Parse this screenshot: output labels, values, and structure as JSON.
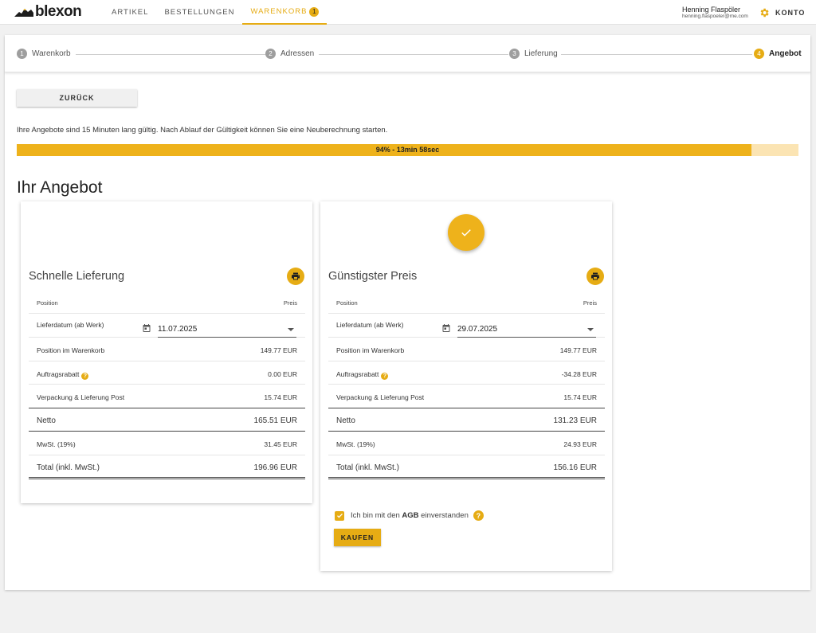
{
  "brand": {
    "name": "blexon",
    "accent": "#e6ac14"
  },
  "nav": {
    "artikel": "ARTIKEL",
    "bestellungen": "BESTELLUNGEN",
    "warenkorb": "WARENKORB",
    "warenkorb_count": "1"
  },
  "user": {
    "name": "Henning Flaspöler",
    "email": "henning.flaspoeler@me.com",
    "konto": "KONTO"
  },
  "stepper": [
    {
      "num": "1",
      "label": "Warenkorb"
    },
    {
      "num": "2",
      "label": "Adressen"
    },
    {
      "num": "3",
      "label": "Lieferung"
    },
    {
      "num": "4",
      "label": "Angebot"
    }
  ],
  "back_label": "ZURÜCK",
  "info_text": "Ihre Angebote sind 15 Minuten lang gültig. Nach Ablauf der Gültigkeit können Sie eine Neuberechnung starten.",
  "progress": {
    "percent": 94,
    "label": "94% - 13min 58sec"
  },
  "offers_title": "Ihr Angebot",
  "offers": [
    {
      "name": "Schnelle Lieferung",
      "col_position": "Position",
      "col_preis": "Preis",
      "lieferdatum_label": "Lieferdatum (ab Werk)",
      "lieferdatum": "11.07.2025",
      "warenkorb_label": "Position im Warenkorb",
      "warenkorb": "149.77 EUR",
      "rabatt_label": "Auftragsrabatt",
      "rabatt": "0.00 EUR",
      "versand_label": "Verpackung & Lieferung Post",
      "versand": "15.74 EUR",
      "netto_label": "Netto",
      "netto": "165.51 EUR",
      "mwst_label": "MwSt. (19%)",
      "mwst": "31.45 EUR",
      "total_label": "Total (inkl. MwSt.)",
      "total": "196.96 EUR"
    },
    {
      "name": "Günstigster Preis",
      "col_position": "Position",
      "col_preis": "Preis",
      "lieferdatum_label": "Lieferdatum (ab Werk)",
      "lieferdatum": "29.07.2025",
      "warenkorb_label": "Position im Warenkorb",
      "warenkorb": "149.77 EUR",
      "rabatt_label": "Auftragsrabatt",
      "rabatt": "-34.28 EUR",
      "versand_label": "Verpackung & Lieferung Post",
      "versand": "15.74 EUR",
      "netto_label": "Netto",
      "netto": "131.23 EUR",
      "mwst_label": "MwSt. (19%)",
      "mwst": "24.93 EUR",
      "total_label": "Total (inkl. MwSt.)",
      "total": "156.16 EUR",
      "agb_prefix": "Ich bin mit den ",
      "agb_bold": "AGB",
      "agb_suffix": " einverstanden",
      "agb_checked": true,
      "kaufen_label": "KAUFEN"
    }
  ]
}
